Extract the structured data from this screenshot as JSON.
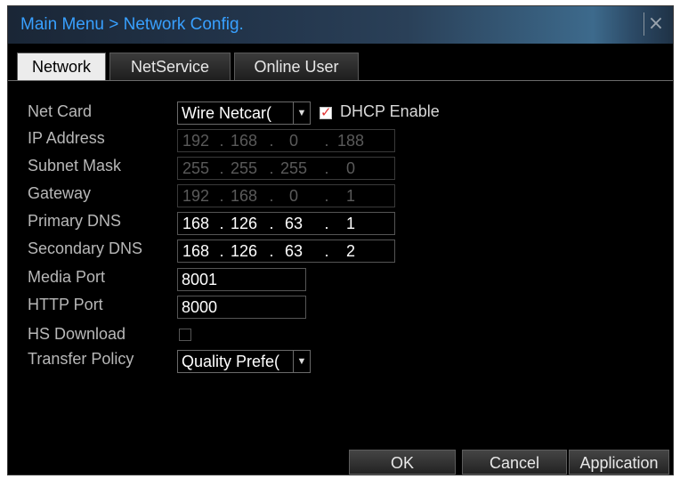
{
  "window": {
    "title": "Main Menu > Network Config.",
    "close_glyph": "×"
  },
  "tabs": [
    {
      "label": "Network",
      "active": true
    },
    {
      "label": "NetService",
      "active": false
    },
    {
      "label": "Online User",
      "active": false
    }
  ],
  "form": {
    "net_card": {
      "label": "Net Card",
      "value": "Wire Netcard",
      "display": "Wire Netcar(",
      "dhcp_label": "DHCP Enable",
      "dhcp_checked": true
    },
    "ip_address": {
      "label": "IP Address",
      "octets": [
        "192",
        "168",
        "0",
        "188"
      ],
      "enabled": false
    },
    "subnet_mask": {
      "label": "Subnet Mask",
      "octets": [
        "255",
        "255",
        "255",
        "0"
      ],
      "enabled": false
    },
    "gateway": {
      "label": "Gateway",
      "octets": [
        "192",
        "168",
        "0",
        "1"
      ],
      "enabled": false
    },
    "primary_dns": {
      "label": "Primary DNS",
      "octets": [
        "168",
        "126",
        "63",
        "1"
      ],
      "enabled": true
    },
    "secondary_dns": {
      "label": "Secondary DNS",
      "octets": [
        "168",
        "126",
        "63",
        "2"
      ],
      "enabled": true
    },
    "media_port": {
      "label": "Media Port",
      "value": "8001"
    },
    "http_port": {
      "label": "HTTP Port",
      "value": "8000"
    },
    "hs_download": {
      "label": "HS Download",
      "checked": false
    },
    "transfer_policy": {
      "label": "Transfer Policy",
      "display": "Quality Prefe("
    }
  },
  "buttons": {
    "ok": "OK",
    "cancel": "Cancel",
    "application": "Application"
  },
  "colors": {
    "title_text": "#38a0ff",
    "background": "#000000",
    "label_text": "#b8b8b8",
    "disabled_text": "#5a5a5a",
    "check_mark": "#e03030"
  }
}
